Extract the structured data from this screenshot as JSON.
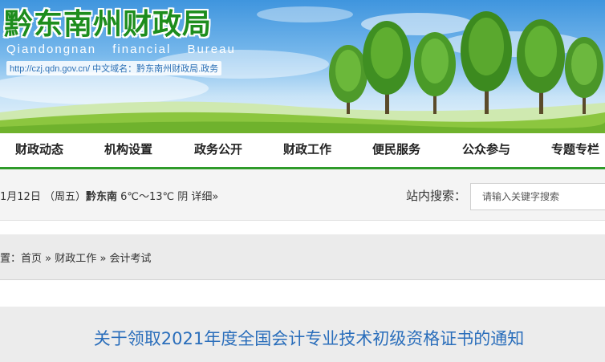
{
  "header": {
    "title": "黔东南州财政局",
    "subtitle": "Qiandongnan financial Bureau",
    "domain_text": "http://czj.qdn.gov.cn/ 中文域名：黔东南州财政局.政务"
  },
  "nav": {
    "items": [
      {
        "label": "财政动态"
      },
      {
        "label": "机构设置"
      },
      {
        "label": "政务公开"
      },
      {
        "label": "财政工作"
      },
      {
        "label": "便民服务"
      },
      {
        "label": "公众参与"
      },
      {
        "label": "专题专栏"
      }
    ]
  },
  "infobar": {
    "date": "1月12日 （周五）",
    "city": "黔东南",
    "weather": "6℃～13℃ 阴",
    "detail_link": "详细»",
    "search_label": "站内搜索：",
    "search_placeholder": "请输入关键字搜索"
  },
  "breadcrumb": {
    "prefix": "置：",
    "items": [
      "首页",
      "财政工作",
      "会计考试"
    ],
    "separator": "»"
  },
  "article": {
    "title": "关于领取2021年度全国会计专业技术初级资格证书的通知"
  },
  "colors": {
    "brand_green": "#2f9b2a",
    "title_blue": "#2a6ebb",
    "sky_blue": "#3f95de"
  }
}
